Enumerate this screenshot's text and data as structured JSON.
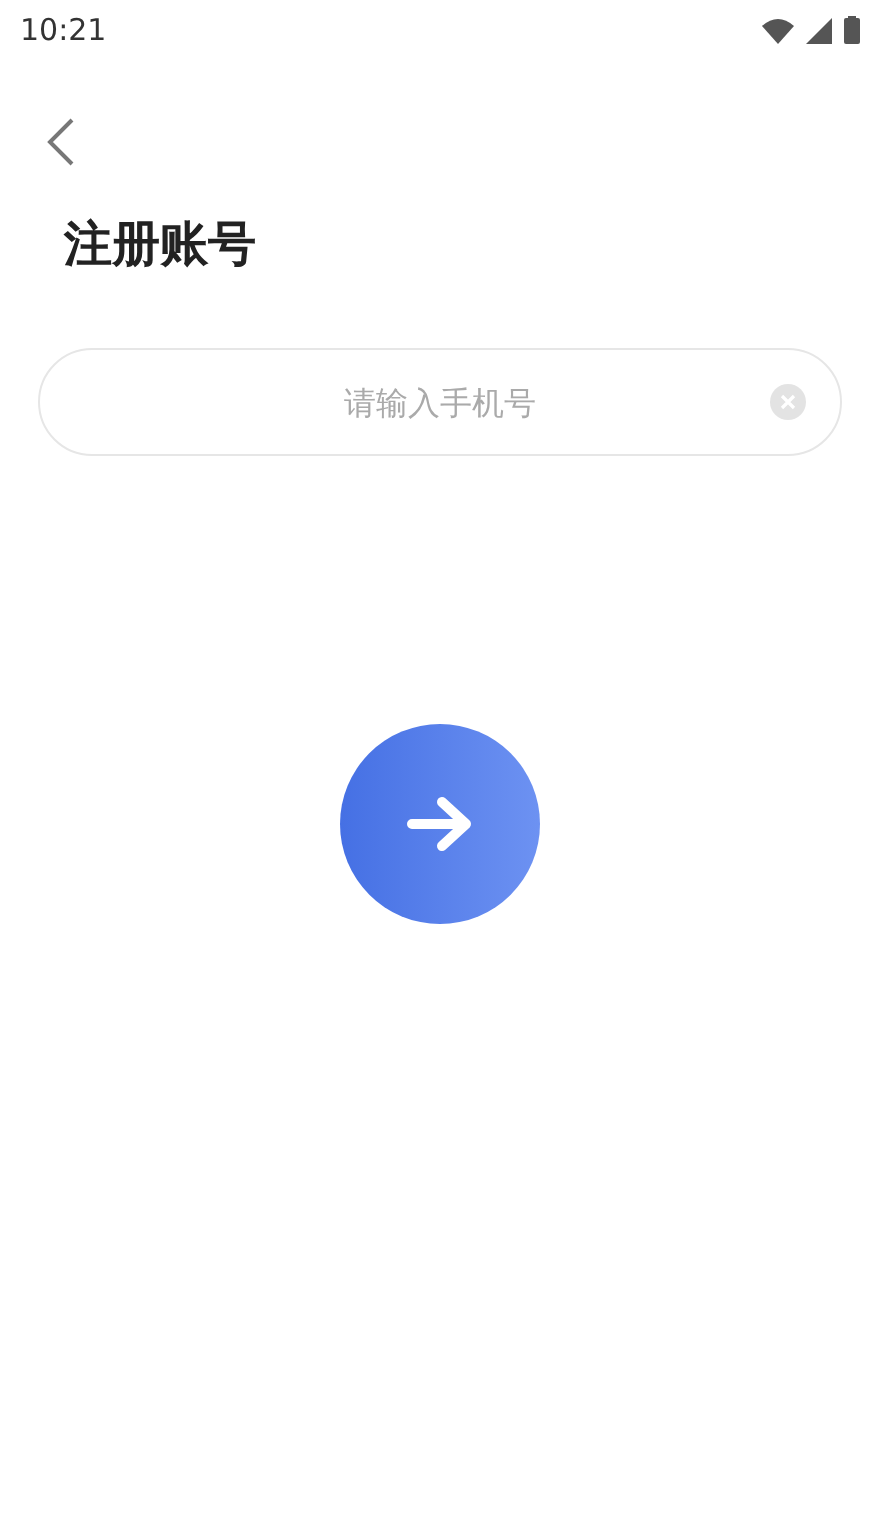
{
  "status_bar": {
    "time": "10:21"
  },
  "title": "注册账号",
  "phone_field": {
    "placeholder": "请输入手机号"
  }
}
